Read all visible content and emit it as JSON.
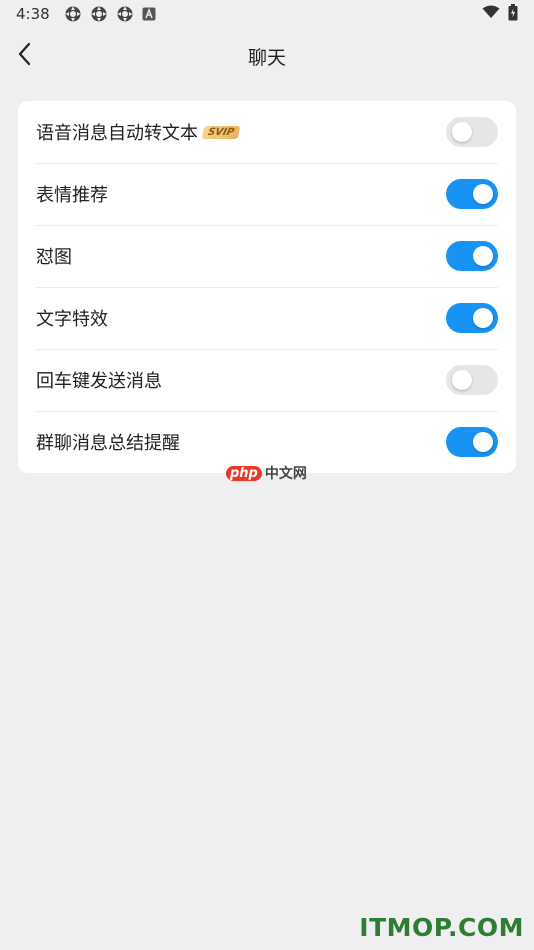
{
  "status_bar": {
    "time": "4:38",
    "notif_icons": [
      "notification-icon",
      "notification-icon",
      "notification-icon",
      "a-app-icon"
    ],
    "right_icons": [
      "wifi-icon",
      "battery-icon"
    ]
  },
  "nav": {
    "title": "聊天",
    "back_icon": "chevron-left-icon"
  },
  "settings": [
    {
      "label": "语音消息自动转文本",
      "badge": "SVIP",
      "on": false
    },
    {
      "label": "表情推荐",
      "on": true
    },
    {
      "label": "怼图",
      "on": true
    },
    {
      "label": "文字特效",
      "on": true
    },
    {
      "label": "回车键发送消息",
      "on": false
    },
    {
      "label": "群聊消息总结提醒",
      "on": true
    }
  ],
  "colors": {
    "toggle_on": "#1793f3",
    "toggle_off": "#e6e6e8",
    "page_bg": "#efeff1"
  },
  "watermarks": {
    "php_logo": "php",
    "php_cn": "中文网",
    "itmop": "ITMOP.COM"
  }
}
